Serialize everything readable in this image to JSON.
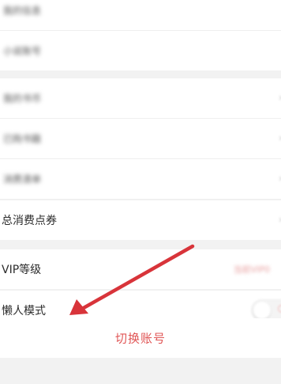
{
  "settings": {
    "rows": [
      {
        "label": "我的信息"
      },
      {
        "label": "小说账号"
      },
      {
        "label": "我的书币"
      },
      {
        "label": "已购书籍"
      },
      {
        "label": "消费清单"
      },
      {
        "label": "总消费点券",
        "chevron": "›"
      },
      {
        "label": "VIP等级",
        "value": "当前VIP0"
      },
      {
        "label": "懒人模式",
        "toggle_on": false,
        "toggle_mark": "○"
      }
    ],
    "switch_account_label": "切换账号"
  },
  "colors": {
    "background": "#f2f2f2",
    "row_background": "#ffffff",
    "accent_red": "#e05555",
    "annotation_arrow": "#d8343a"
  },
  "icons": {
    "row_chevron": "chevron-right-icon",
    "annotation": "red-arrow-icon"
  }
}
